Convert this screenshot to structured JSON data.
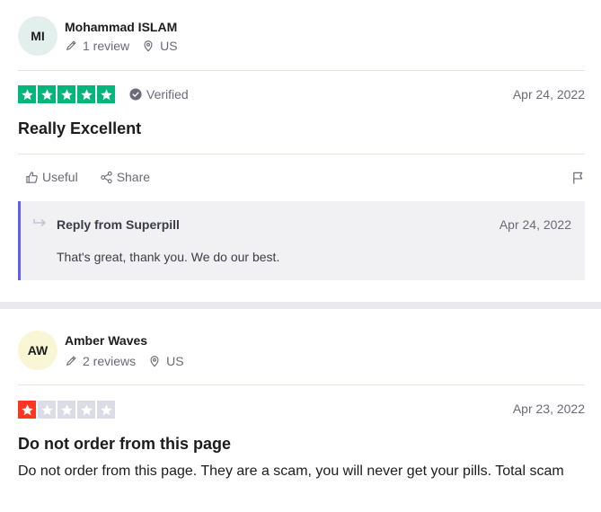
{
  "reviews": [
    {
      "avatar_initials": "MI",
      "author": "Mohammad ISLAM",
      "review_count": "1 review",
      "country": "US",
      "rating": 5,
      "verified_label": "Verified",
      "date": "Apr 24, 2022",
      "title": "Really Excellent",
      "actions": {
        "useful_label": "Useful",
        "share_label": "Share"
      },
      "reply": {
        "header": "Reply from Superpill",
        "date": "Apr 24, 2022",
        "text": "That's great, thank you. We do our best."
      }
    },
    {
      "avatar_initials": "AW",
      "author": "Amber Waves",
      "review_count": "2 reviews",
      "country": "US",
      "rating": 1,
      "date": "Apr 23, 2022",
      "title": "Do not order from this page",
      "body": "Do not order from this page. They are a scam, you will never get your pills. Total scam"
    }
  ],
  "colors": {
    "five_star": "#00b67a",
    "one_star": "#ff3722",
    "empty_star": "#dcdce6",
    "reply_accent": "#5d5fe8"
  },
  "icons": [
    "pencil-icon",
    "location-pin-icon",
    "verified-check-icon",
    "thumbs-up-icon",
    "share-icon",
    "flag-icon",
    "reply-arrow-icon",
    "star-icon"
  ]
}
